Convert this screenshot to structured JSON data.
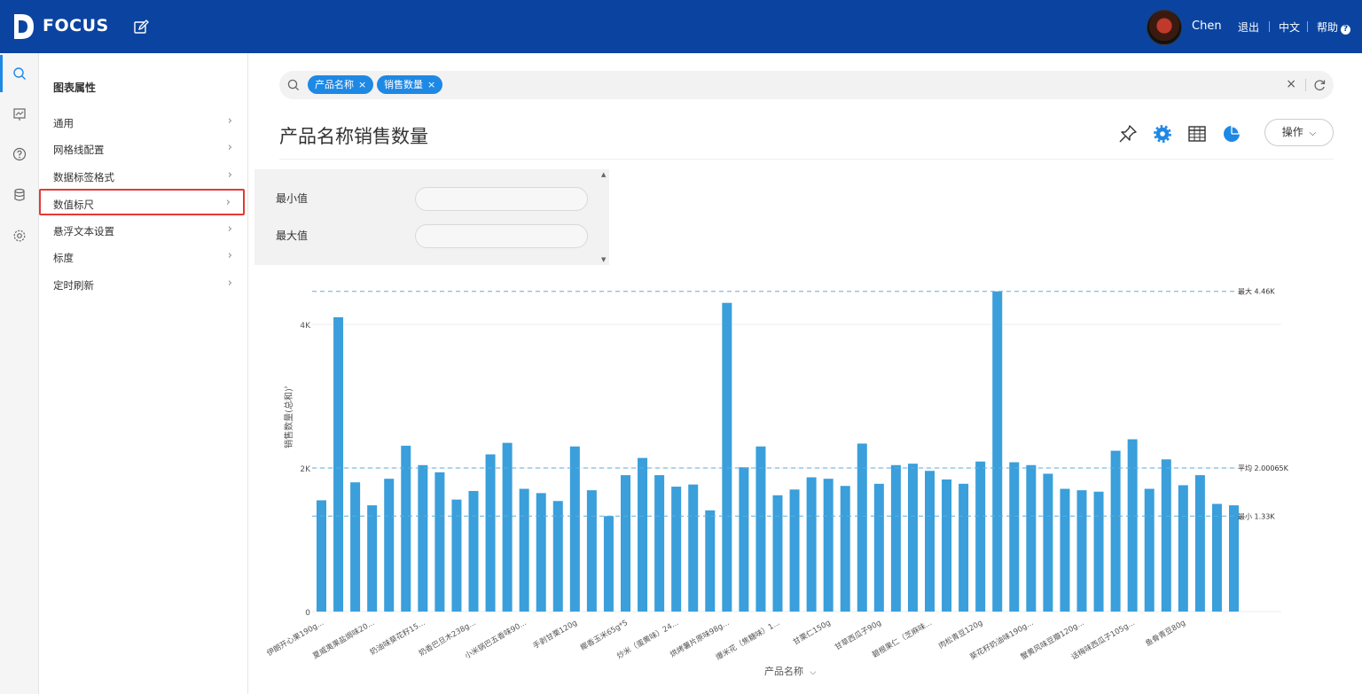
{
  "app": {
    "brand": "FOCUS",
    "user": "Chen",
    "logout": "退出",
    "language": "中文",
    "help": "帮助",
    "help_mark": "?"
  },
  "panel": {
    "title": "图表属性",
    "items": [
      {
        "label": "通用"
      },
      {
        "label": "网格线配置"
      },
      {
        "label": "数据标签格式"
      },
      {
        "label": "数值标尺",
        "selected": true
      },
      {
        "label": "悬浮文本设置"
      },
      {
        "label": "标度"
      },
      {
        "label": "定时刷新"
      }
    ],
    "chevron": "›"
  },
  "search": {
    "chips": [
      "产品名称",
      "销售数量"
    ],
    "clear": "×"
  },
  "chart_header": {
    "title": "产品名称销售数量",
    "ops_label": "操作",
    "ops_caret": "⌵"
  },
  "axis_range": {
    "min_label": "最小值",
    "max_label": "最大值",
    "min_value": "",
    "max_value": ""
  },
  "colors": {
    "topbar": "#0b44a0",
    "bar": "#3a9fdb",
    "accent": "#1e88e5",
    "refline": "#5aaee0",
    "selected_border": "#e53935"
  },
  "icons": [
    "search-icon",
    "presentation-icon",
    "help-circle-icon",
    "database-icon",
    "settings-icon",
    "edit-icon",
    "pin-icon",
    "gear-icon",
    "table-icon",
    "pie-chart-icon",
    "refresh-icon"
  ],
  "chart_data": {
    "type": "bar",
    "xlabel": "产品名称",
    "ylabel": "销售数量(总和)",
    "ylim": [
      0,
      4500
    ],
    "yticks": [
      0,
      2000,
      4000
    ],
    "ytick_labels": [
      "0",
      "2K",
      "4K"
    ],
    "reference_lines": [
      {
        "label": "最大 4.46K",
        "value": 4460
      },
      {
        "label": "平均 2.00065K",
        "value": 2000.65
      },
      {
        "label": "最小 1.33K",
        "value": 1330
      }
    ],
    "category_labels_shown": [
      {
        "index": 0,
        "text": "伊朗开心果190g..."
      },
      {
        "index": 3,
        "text": "夏威夷果盐焗味20..."
      },
      {
        "index": 6,
        "text": "奶油味葵花籽15..."
      },
      {
        "index": 9,
        "text": "奶香巴旦木238g..."
      },
      {
        "index": 12,
        "text": "小米锅巴五香味90..."
      },
      {
        "index": 15,
        "text": "手剥甘栗120g"
      },
      {
        "index": 18,
        "text": "椰香玉米65g*5"
      },
      {
        "index": 21,
        "text": "炒米（蛋黄味）24..."
      },
      {
        "index": 24,
        "text": "烘烤薯片原味98g..."
      },
      {
        "index": 27,
        "text": "爆米花（焦糖味）1..."
      },
      {
        "index": 30,
        "text": "甘栗仁150g"
      },
      {
        "index": 33,
        "text": "甘草西瓜子90g"
      },
      {
        "index": 36,
        "text": "碧根果仁（芝麻味..."
      },
      {
        "index": 39,
        "text": "肉松青豆120g"
      },
      {
        "index": 42,
        "text": "葵花籽奶油味190g..."
      },
      {
        "index": 45,
        "text": "蟹黄风味豆瓣120g..."
      },
      {
        "index": 48,
        "text": "话梅味西瓜子105g..."
      },
      {
        "index": 51,
        "text": "鱼骨青豆80g"
      }
    ],
    "values": [
      1550,
      4100,
      1800,
      1480,
      1850,
      2310,
      2040,
      1940,
      1560,
      1680,
      2190,
      2350,
      1710,
      1650,
      1540,
      2300,
      1690,
      1330,
      1900,
      2140,
      1900,
      1740,
      1770,
      1410,
      4300,
      2010,
      2300,
      1620,
      1700,
      1870,
      1850,
      1750,
      2340,
      1780,
      2040,
      2060,
      1960,
      1840,
      1780,
      2090,
      4460,
      2080,
      2040,
      1920,
      1710,
      1690,
      1670,
      2240,
      2400,
      1710,
      2120,
      1760,
      1900,
      1500,
      1480
    ]
  }
}
